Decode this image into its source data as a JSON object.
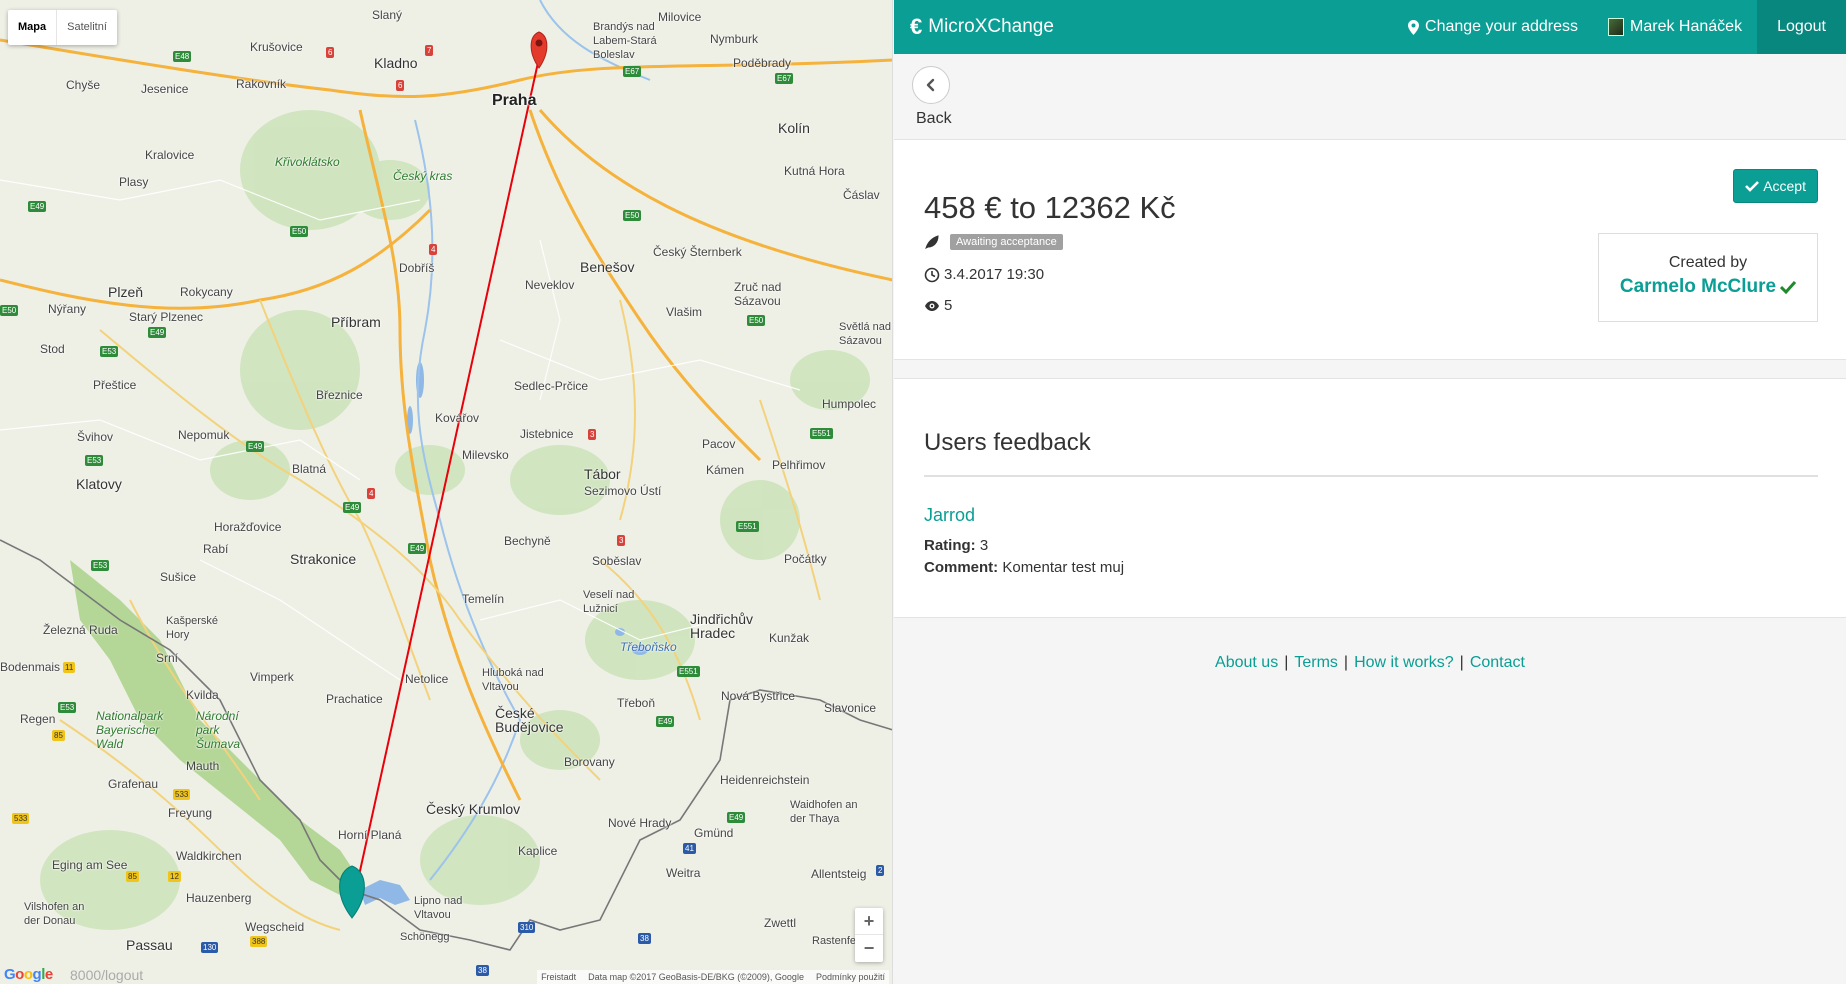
{
  "map": {
    "type_buttons": [
      "Mapa",
      "Satelitní"
    ],
    "zoom_in": "+",
    "zoom_out": "−",
    "url_hint": "8000/logout",
    "attribution": [
      "Freistadt",
      "Data map ©2017 GeoBasis-DE/BKG (©2009), Google",
      "Podmínky použití"
    ],
    "labels": {
      "praha": "Praha",
      "kladno": "Kladno",
      "slany": "Slaný",
      "brandys": "Brandýs nad Labem-Stará Boleslav",
      "milovice": "Milovice",
      "nymburk": "Nymburk",
      "podebrady": "Poděbrady",
      "kolin": "Kolín",
      "kutna_hora": "Kutná Hora",
      "caslav": "Čáslav",
      "rakovnik": "Rakovník",
      "krusovice": "Krušovice",
      "jesenice": "Jesenice",
      "chyse": "Chyše",
      "kralovice": "Kralovice",
      "plasy": "Plasy",
      "krivoklatsko": "Křivoklátsko",
      "cesky_kras": "Český kras",
      "dobris": "Dobříš",
      "benesov": "Benešov",
      "neveklov": "Neveklov",
      "cesky_sternberk": "Český Šternberk",
      "plzen": "Plzeň",
      "rokycany": "Rokycany",
      "nyrany": "Nýřany",
      "stary_plzenec": "Starý Plzenec",
      "pribram": "Příbram",
      "vlasim": "Vlašim",
      "zruc": "Zruč nad Sázavou",
      "svetla": "Světlá nad Sázavou",
      "stod": "Stod",
      "prestice": "Přeštice",
      "breznice": "Březnice",
      "sedlec": "Sedlec-Prčice",
      "humpolec": "Humpolec",
      "svihov": "Švihov",
      "nepomuk": "Nepomuk",
      "kovarov": "Kovářov",
      "jistebnice": "Jistebnice",
      "milevsko": "Milevsko",
      "pacov": "Pacov",
      "kamen": "Kámen",
      "pelhrimov": "Pelhřimov",
      "klatovy": "Klatovy",
      "blatna": "Blatná",
      "tabor": "Tábor",
      "sezimovo": "Sezimovo Ústí",
      "horazdovice": "Horažďovice",
      "rabi": "Rabí",
      "strakonice": "Strakonice",
      "bechyne": "Bechyně",
      "sobeslav": "Soběslav",
      "pocatky": "Počátky",
      "susice": "Sušice",
      "temelin": "Temelín",
      "veseli": "Veselí nad Lužnicí",
      "jindrichuv": "Jindřichův Hradec",
      "zelezna_ruda": "Železná Ruda",
      "kasperske": "Kašperské Hory",
      "srni": "Srní",
      "trebonsko": "Třeboňsko",
      "kunzak": "Kunžak",
      "bodenmais": "Bodenmais",
      "vimperk": "Vimperk",
      "netolice": "Netolice",
      "hluboka": "Hluboká nad Vltavou",
      "kvilda": "Kvilda",
      "prachatice": "Prachatice",
      "ceske_budejovice": "České Budějovice",
      "trebon": "Třeboň",
      "nova_bystrice": "Nová Bystřice",
      "slavonice": "Slavonice",
      "regen": "Regen",
      "np_bayerischer": "Nationalpark Bayerischer Wald",
      "np_sumava": "Národní park Šumava",
      "mauth": "Mauth",
      "borovany": "Borovany",
      "grafenau": "Grafenau",
      "heidenreichstein": "Heidenreichstein",
      "freyung": "Freyung",
      "cesky_krumlov": "Český Krumlov",
      "nove_hrady": "Nové Hrady",
      "gmund": "Gmünd",
      "waidhofen": "Waidhofen an der Thaya",
      "horni_plana": "Horní Planá",
      "waldkirchen": "Waldkirchen",
      "kaplice": "Kaplice",
      "eging": "Eging am See",
      "weitra": "Weitra",
      "allentsteig": "Allentsteig",
      "hauzenberg": "Hauzenberg",
      "lipno": "Lipno nad Vltavou",
      "vilshofen": "Vilshofen an der Donau",
      "wegscheid": "Wegscheid",
      "zwettl": "Zwettl",
      "schonegg": "Schönegg",
      "passau": "Passau",
      "rastenfeld": "Rastenfeld"
    }
  },
  "navbar": {
    "brand_icon": "€",
    "brand": "MicroXChange",
    "change_address": "Change your address",
    "user_name": "Marek Hanáček",
    "logout": "Logout"
  },
  "back": {
    "label": "Back"
  },
  "offer": {
    "title": "458 € to 12362 Kč",
    "status": "Awaiting acceptance",
    "datetime": "3.4.2017 19:30",
    "views": "5",
    "accept_label": "Accept",
    "created_by_label": "Created by",
    "creator_name": "Carmelo McClure"
  },
  "feedback": {
    "title": "Users feedback",
    "items": [
      {
        "user": "Jarrod",
        "rating_label": "Rating:",
        "rating": "3",
        "comment_label": "Comment:",
        "comment": "Komentar test muj"
      }
    ]
  },
  "footer": {
    "links": [
      "About us",
      "Terms",
      "How it works?",
      "Contact"
    ],
    "separator": "|"
  },
  "colors": {
    "accent": "#0a9e94",
    "route_line": "#e8000b",
    "status_badge": "#a0a0a0",
    "verified": "#1e8a2b"
  }
}
